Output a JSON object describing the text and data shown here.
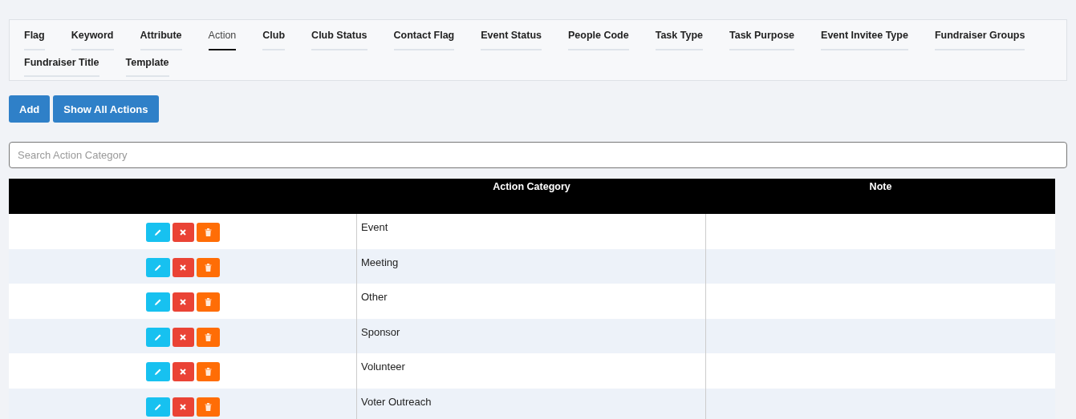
{
  "tabs": [
    {
      "label": "Flag",
      "selected": false
    },
    {
      "label": "Keyword",
      "selected": false
    },
    {
      "label": "Attribute",
      "selected": false
    },
    {
      "label": "Action",
      "selected": true
    },
    {
      "label": "Club",
      "selected": false
    },
    {
      "label": "Club Status",
      "selected": false
    },
    {
      "label": "Contact Flag",
      "selected": false
    },
    {
      "label": "Event Status",
      "selected": false
    },
    {
      "label": "People Code",
      "selected": false
    },
    {
      "label": "Task Type",
      "selected": false
    },
    {
      "label": "Task Purpose",
      "selected": false
    },
    {
      "label": "Event Invitee Type",
      "selected": false
    },
    {
      "label": "Fundraiser Groups",
      "selected": false
    },
    {
      "label": "Fundraiser Title",
      "selected": false
    },
    {
      "label": "Template",
      "selected": false
    }
  ],
  "buttons": [
    "Add",
    "Show All Actions"
  ],
  "search": {
    "placeholder": "Search Action Category"
  },
  "table": {
    "columns": [
      "Action Category",
      "Note"
    ],
    "rows": [
      {
        "category": "Event"
      },
      {
        "category": "Meeting"
      },
      {
        "category": "Other"
      },
      {
        "category": "Sponsor"
      },
      {
        "category": "Volunteer"
      },
      {
        "category": "Voter Outreach"
      }
    ]
  }
}
